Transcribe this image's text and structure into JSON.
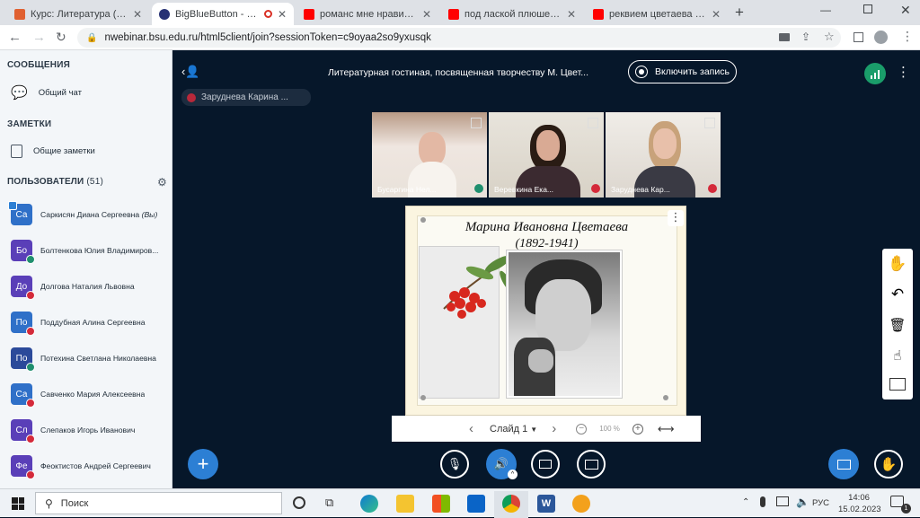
{
  "tabs": [
    {
      "title": "Курс: Литература (Инжин...",
      "color": "#e06030"
    },
    {
      "title": "BigBlueButton - Литер...",
      "color": "#283274",
      "active": true
    },
    {
      "title": "романс мне нравится чт...",
      "color": "#ff0000"
    },
    {
      "title": "под лаской плюшевого п...",
      "color": "#ff0000"
    },
    {
      "title": "реквием цветаева - YouT...",
      "color": "#ff0000"
    }
  ],
  "url": "nwebinar.bsu.edu.ru/html5client/join?sessionToken=c9oyaa2so9yxusqk",
  "sidebar": {
    "messages_title": "СООБЩЕНИЯ",
    "public_chat": "Общий чат",
    "notes_title": "ЗАМЕТКИ",
    "shared_notes": "Общие заметки",
    "users_title": "ПОЛЬЗОВАТЕЛИ",
    "users_count": "(51)",
    "users": [
      {
        "initials": "Са",
        "name": "Саркисян Диана Сергеевна",
        "suffix": "(Вы)",
        "color": "#2f70c8",
        "status": "presenter"
      },
      {
        "initials": "Бо",
        "name": "Болтенкова Юлия Владимиров...",
        "color": "#5a3fb8",
        "status": "listen"
      },
      {
        "initials": "До",
        "name": "Долгова Наталия Львовна",
        "color": "#5a3fb8",
        "status": "muted"
      },
      {
        "initials": "По",
        "name": "Поддубная Алина Сергеевна",
        "color": "#2f70c8",
        "status": "muted"
      },
      {
        "initials": "По",
        "name": "Потехина Светлана Николаевна",
        "color": "#2b4a9a",
        "status": "listen"
      },
      {
        "initials": "Са",
        "name": "Савченко Мария Алексеевна",
        "color": "#2f70c8",
        "status": "muted"
      },
      {
        "initials": "Сл",
        "name": "Слепаков Игорь Иванович",
        "color": "#5a3fb8",
        "status": "muted"
      },
      {
        "initials": "Фе",
        "name": "Феоктистов Андрей Сергеевич",
        "color": "#5a3fb8",
        "status": "muted"
      }
    ]
  },
  "meeting": {
    "title": "Литературная гостиная, посвященная творчеству М. Цвет...",
    "record_label": "Включить запись",
    "talking": "Заруднева Карина ..."
  },
  "videos": [
    {
      "name": "Бусаргина Нел...",
      "mic": "on"
    },
    {
      "name": "Веревкина Ека...",
      "mic": "off"
    },
    {
      "name": "Заруднева Кар...",
      "mic": "off"
    }
  ],
  "slide": {
    "heading": "Марина Ивановна Цветаева",
    "years": "(1892-1941)"
  },
  "controls": {
    "slide_label": "Слайд 1",
    "zoom": "100 %"
  },
  "taskbar": {
    "search": "Поиск",
    "lang": "РУС",
    "time": "14:06",
    "date": "15.02.2023",
    "notif": "1"
  },
  "colors": {
    "bg": "#06172a",
    "accent": "#2c7fd4",
    "muted": "#d42a3a",
    "listen": "#1f8f6e"
  }
}
